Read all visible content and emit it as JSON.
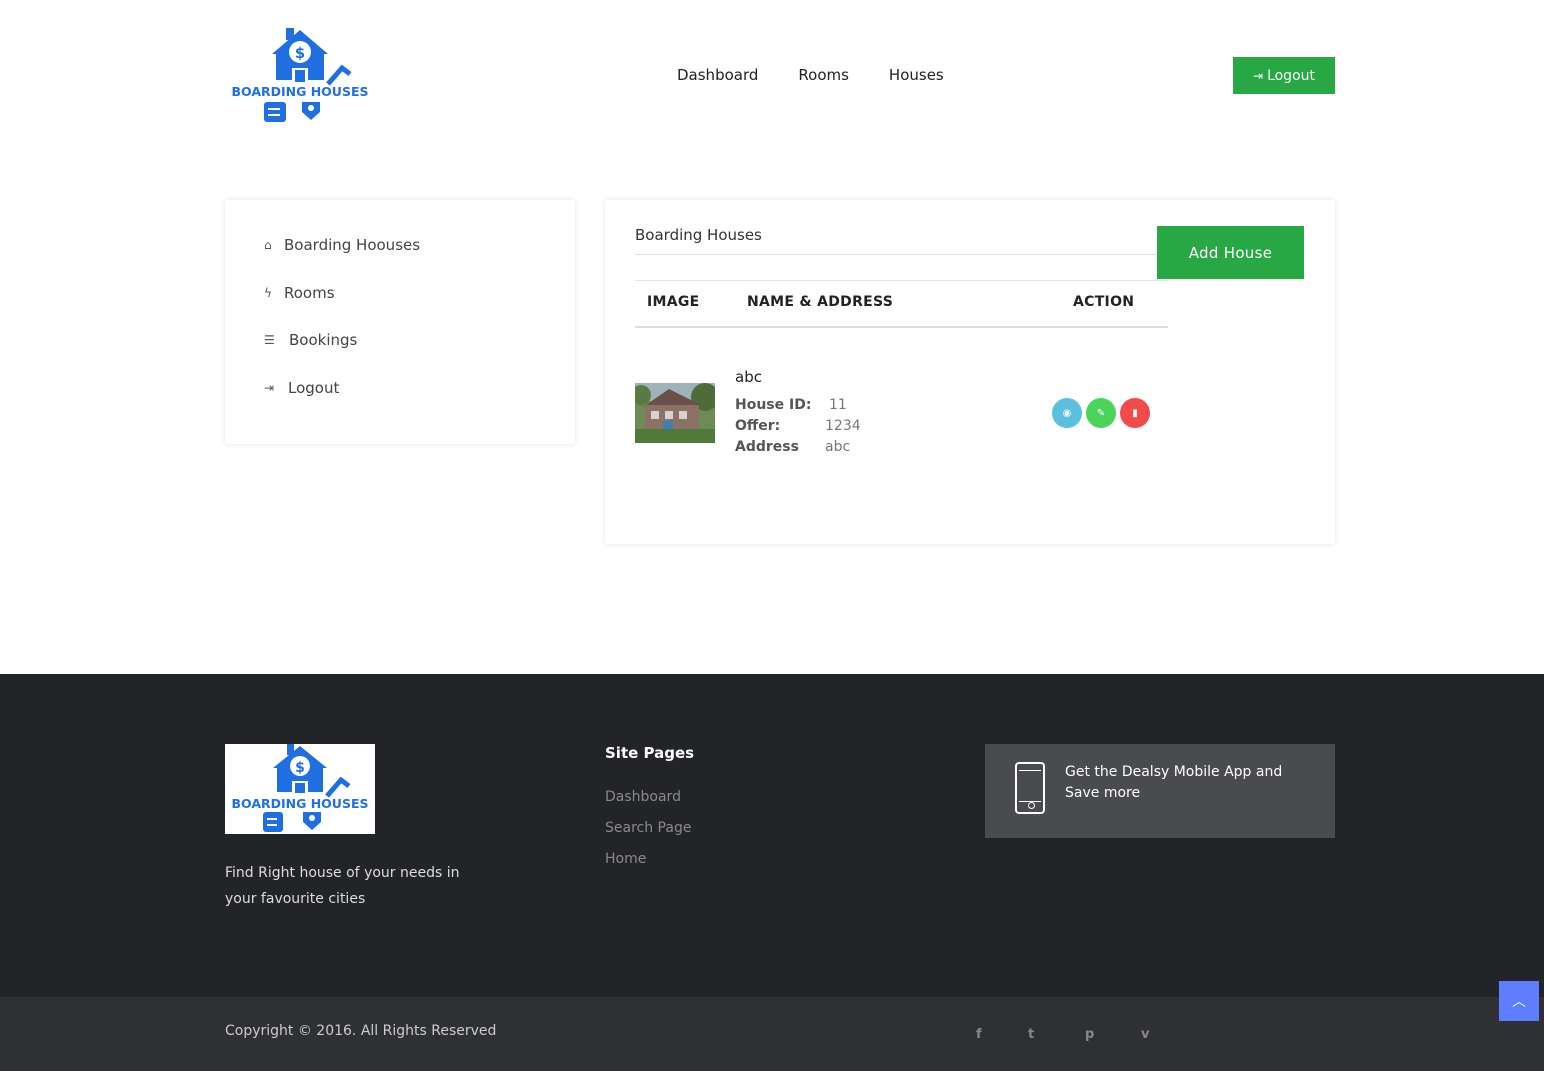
{
  "brand": {
    "name": "BOARDING HOUSES",
    "color": "#1f6fe0"
  },
  "nav": {
    "items": [
      "Dashboard",
      "Rooms",
      "Houses"
    ],
    "logout_label": "Logout"
  },
  "sidebar": {
    "items": [
      {
        "label": "Boarding Hoouses",
        "icon": "home-icon"
      },
      {
        "label": "Rooms",
        "icon": "bolt-icon"
      },
      {
        "label": "Bookings",
        "icon": "list-icon"
      },
      {
        "label": "Logout",
        "icon": "sign-out-icon"
      }
    ]
  },
  "main": {
    "title": "Boarding Houses",
    "add_button": "Add House",
    "columns": [
      "IMAGE",
      "NAME & ADDRESS",
      "ACTION"
    ],
    "rows": [
      {
        "name": "abc",
        "id_label": "House ID:",
        "id_value": "11",
        "offer_label": "Offer:",
        "offer_value": "1234",
        "address_label": "Address",
        "address_value": "abc"
      }
    ],
    "action_colors": {
      "view": "#5bc0de",
      "edit": "#4cd35a",
      "delete": "#f24b4b"
    }
  },
  "footer": {
    "tagline": "Find Right house of your needs in your favourite cities",
    "site_pages_title": "Site Pages",
    "links": [
      "Dashboard",
      "Search Page",
      "Home"
    ],
    "app_promo": "Get the Dealsy Mobile App and Save more",
    "copyright": "Copyright © 2016. All Rights Reserved",
    "social": [
      "facebook-icon",
      "twitter-icon",
      "pinterest-icon",
      "vimeo-icon"
    ]
  },
  "accent_green": "#28a745"
}
